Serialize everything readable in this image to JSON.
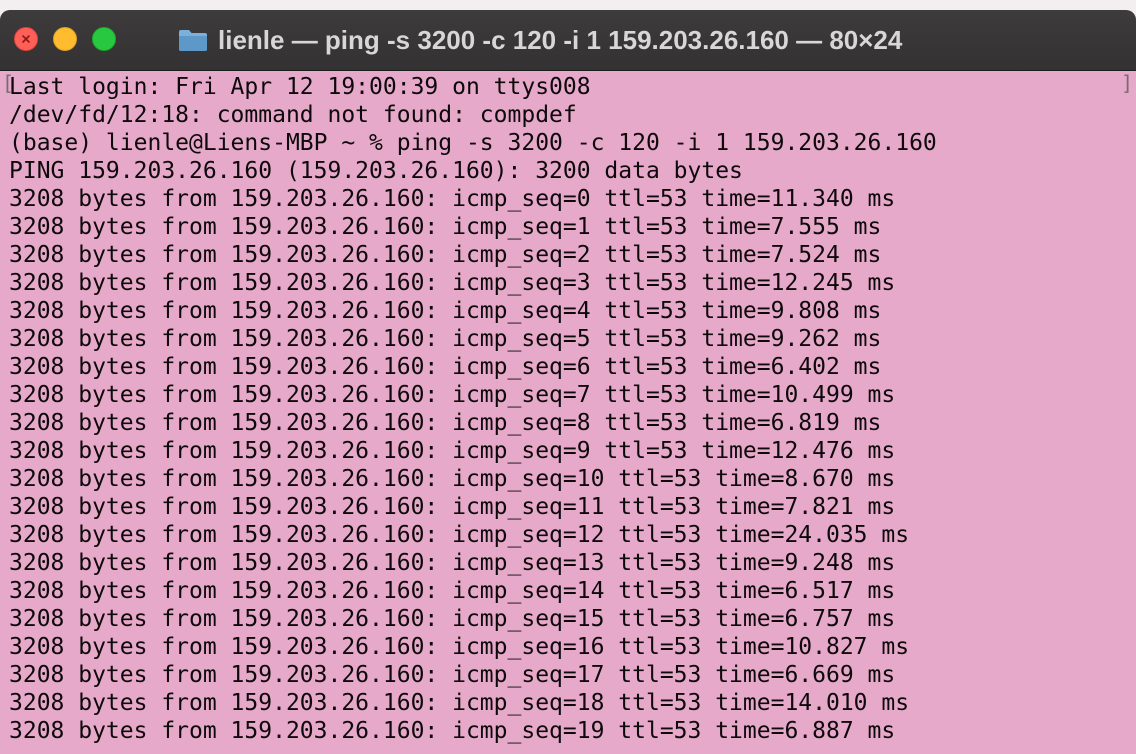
{
  "window": {
    "title": "lienle — ping -s 3200 -c 120 -i 1 159.203.26.160 — 80×24",
    "icon": "folder-icon",
    "colors": {
      "background": "#e7a9c9",
      "titlebar": "#383637",
      "text": "#0e0a0c",
      "close": "#fe5f57",
      "minimize": "#febc2e",
      "zoom": "#28c840"
    }
  },
  "terminal": {
    "lines": [
      "Last login: Fri Apr 12 19:00:39 on ttys008",
      "/dev/fd/12:18: command not found: compdef",
      "(base) lienle@Liens-MBP ~ % ping -s 3200 -c 120 -i 1 159.203.26.160",
      "PING 159.203.26.160 (159.203.26.160): 3200 data bytes",
      "3208 bytes from 159.203.26.160: icmp_seq=0 ttl=53 time=11.340 ms",
      "3208 bytes from 159.203.26.160: icmp_seq=1 ttl=53 time=7.555 ms",
      "3208 bytes from 159.203.26.160: icmp_seq=2 ttl=53 time=7.524 ms",
      "3208 bytes from 159.203.26.160: icmp_seq=3 ttl=53 time=12.245 ms",
      "3208 bytes from 159.203.26.160: icmp_seq=4 ttl=53 time=9.808 ms",
      "3208 bytes from 159.203.26.160: icmp_seq=5 ttl=53 time=9.262 ms",
      "3208 bytes from 159.203.26.160: icmp_seq=6 ttl=53 time=6.402 ms",
      "3208 bytes from 159.203.26.160: icmp_seq=7 ttl=53 time=10.499 ms",
      "3208 bytes from 159.203.26.160: icmp_seq=8 ttl=53 time=6.819 ms",
      "3208 bytes from 159.203.26.160: icmp_seq=9 ttl=53 time=12.476 ms",
      "3208 bytes from 159.203.26.160: icmp_seq=10 ttl=53 time=8.670 ms",
      "3208 bytes from 159.203.26.160: icmp_seq=11 ttl=53 time=7.821 ms",
      "3208 bytes from 159.203.26.160: icmp_seq=12 ttl=53 time=24.035 ms",
      "3208 bytes from 159.203.26.160: icmp_seq=13 ttl=53 time=9.248 ms",
      "3208 bytes from 159.203.26.160: icmp_seq=14 ttl=53 time=6.517 ms",
      "3208 bytes from 159.203.26.160: icmp_seq=15 ttl=53 time=6.757 ms",
      "3208 bytes from 159.203.26.160: icmp_seq=16 ttl=53 time=10.827 ms",
      "3208 bytes from 159.203.26.160: icmp_seq=17 ttl=53 time=6.669 ms",
      "3208 bytes from 159.203.26.160: icmp_seq=18 ttl=53 time=14.010 ms",
      "3208 bytes from 159.203.26.160: icmp_seq=19 ttl=53 time=6.887 ms"
    ],
    "marks": {
      "left": "[",
      "right": "]"
    }
  }
}
